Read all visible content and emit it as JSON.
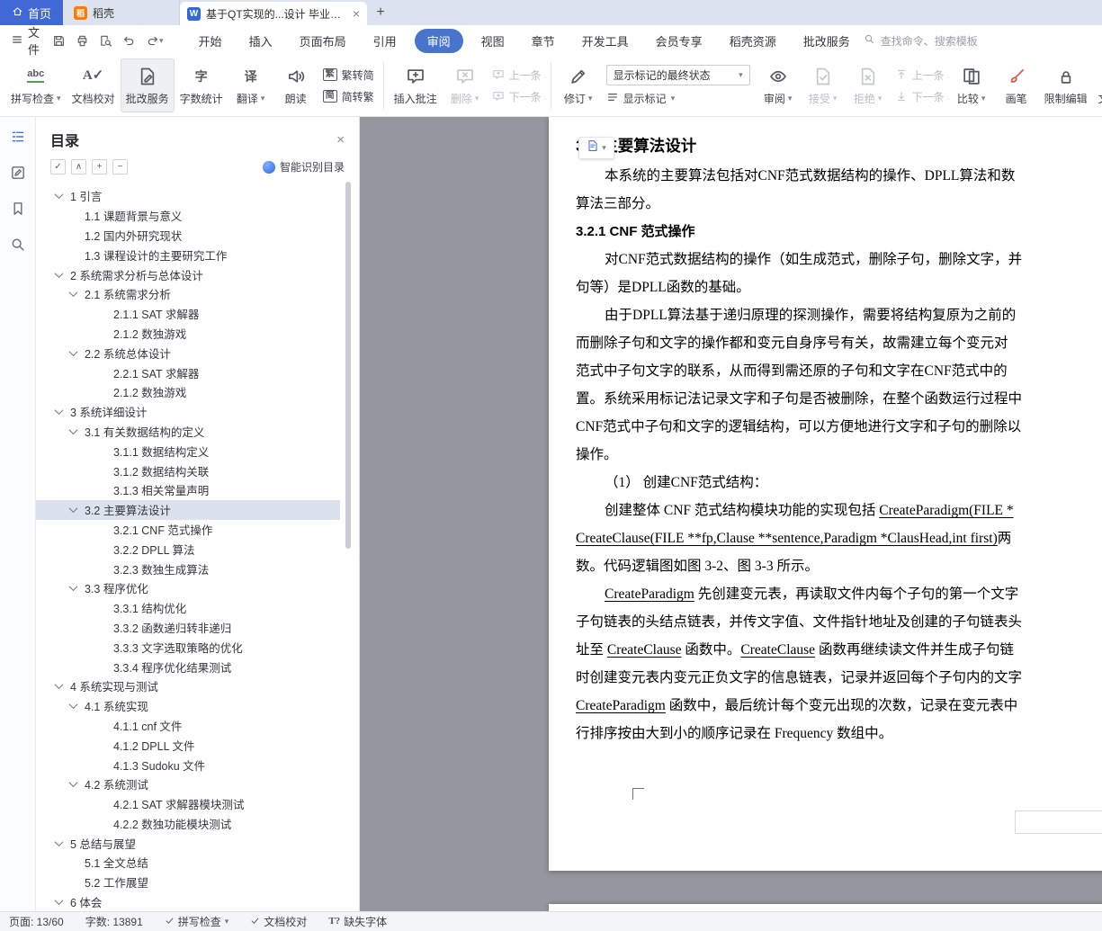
{
  "titlebar": {
    "home_tab": "首页",
    "docer_tab": "稻壳",
    "doc_tab": "基于QT实现的...设计 毕业论文",
    "close_glyph": "×",
    "new_tab_glyph": "+"
  },
  "menubar": {
    "file": "文件",
    "quick_access": [
      {
        "icon": "save-icon"
      },
      {
        "icon": "print-icon"
      },
      {
        "icon": "preview-icon"
      },
      {
        "icon": "undo-icon"
      },
      {
        "icon": "redo-icon",
        "dropdown": true
      }
    ],
    "items": [
      {
        "label": "开始"
      },
      {
        "label": "插入"
      },
      {
        "label": "页面布局"
      },
      {
        "label": "引用"
      },
      {
        "label": "审阅",
        "active": true
      },
      {
        "label": "视图"
      },
      {
        "label": "章节"
      },
      {
        "label": "开发工具"
      },
      {
        "label": "会员专享"
      },
      {
        "label": "稻壳资源"
      },
      {
        "label": "批改服务"
      }
    ],
    "search": "查找命令、搜索模板"
  },
  "ribbon": {
    "buttons": [
      {
        "type": "big",
        "label": "拼写检查",
        "icon": "spellcheck-icon",
        "dropdown": true
      },
      {
        "type": "big",
        "label": "文档校对",
        "icon": "proofread-icon"
      },
      {
        "type": "big",
        "label": "批改服务",
        "icon": "correction-icon",
        "active": true
      },
      {
        "type": "big",
        "label": "字数统计",
        "icon": "wordcount-icon"
      },
      {
        "type": "big",
        "label": "翻译",
        "icon": "translate-icon",
        "dropdown": true
      },
      {
        "type": "big",
        "label": "朗读",
        "icon": "read-aloud-icon"
      },
      {
        "type": "pair",
        "items": [
          {
            "label": "繁转简",
            "icon": "fan-to-jian-icon"
          },
          {
            "label": "简转繁",
            "icon": "jian-to-fan-icon"
          }
        ]
      },
      {
        "type": "sep"
      },
      {
        "type": "big",
        "label": "插入批注",
        "icon": "insert-comment-icon"
      },
      {
        "type": "big",
        "label": "删除",
        "icon": "delete-comment-icon",
        "dropdown": true,
        "disabled": true
      },
      {
        "type": "pair",
        "items": [
          {
            "label": "上一条",
            "icon": "prev-comment-icon",
            "disabled": true
          },
          {
            "label": "下一条",
            "icon": "next-comment-icon",
            "disabled": true
          }
        ]
      },
      {
        "type": "sep"
      },
      {
        "type": "big",
        "label": "修订",
        "icon": "track-changes-icon",
        "dropdown": true
      },
      {
        "type": "combo",
        "combo_value": "显示标记的最终状态",
        "show_marks_label": "显示标记",
        "show_marks_icon": "marks-list-icon"
      },
      {
        "type": "big",
        "label": "审阅",
        "icon": "review-icon",
        "dropdown": true
      },
      {
        "type": "big",
        "label": "接受",
        "icon": "accept-icon",
        "dropdown": true,
        "disabled": true
      },
      {
        "type": "big",
        "label": "拒绝",
        "icon": "reject-icon",
        "dropdown": true,
        "disabled": true
      },
      {
        "type": "pair",
        "items": [
          {
            "label": "上一条",
            "icon": "prev-change-icon",
            "disabled": true
          },
          {
            "label": "下一条",
            "icon": "next-change-icon",
            "disabled": true
          }
        ]
      },
      {
        "type": "big",
        "label": "比较",
        "icon": "compare-icon",
        "dropdown": true
      },
      {
        "type": "big",
        "label": "画笔",
        "icon": "brush-icon"
      },
      {
        "type": "big",
        "label": "限制编辑",
        "icon": "restrict-edit-icon"
      },
      {
        "type": "big",
        "label": "文档权限",
        "icon": "doc-permission-icon"
      }
    ]
  },
  "leftstrip": {
    "items": [
      {
        "icon": "outline-icon",
        "active": true
      },
      {
        "icon": "annotation-icon"
      },
      {
        "icon": "bookmark-icon"
      },
      {
        "icon": "search-icon"
      }
    ]
  },
  "toc": {
    "title": "目录",
    "close_glyph": "×",
    "tools": [
      {
        "glyph": "✓",
        "name": "toc-check-button"
      },
      {
        "glyph": "∧",
        "name": "toc-collapse-up-button"
      },
      {
        "glyph": "+",
        "name": "toc-expand-all-button"
      },
      {
        "glyph": "−",
        "name": "toc-collapse-all-button"
      }
    ],
    "smart_recognize": "智能识别目录",
    "items": [
      {
        "level": 1,
        "label": "1 引言",
        "chev": true
      },
      {
        "level": 2,
        "label": "1.1 课题背景与意义"
      },
      {
        "level": 2,
        "label": "1.2 国内外研究现状"
      },
      {
        "level": 2,
        "label": "1.3 课程设计的主要研究工作"
      },
      {
        "level": 1,
        "label": "2 系统需求分析与总体设计",
        "chev": true
      },
      {
        "level": 2,
        "label": "2.1 系统需求分析",
        "chev": true
      },
      {
        "level": 3,
        "label": "2.1.1 SAT 求解器"
      },
      {
        "level": 3,
        "label": "2.1.2 数独游戏"
      },
      {
        "level": 2,
        "label": "2.2 系统总体设计",
        "chev": true
      },
      {
        "level": 3,
        "label": "2.2.1 SAT 求解器"
      },
      {
        "level": 3,
        "label": "2.1.2 数独游戏"
      },
      {
        "level": 1,
        "label": "3 系统详细设计",
        "chev": true
      },
      {
        "level": 2,
        "label": "3.1 有关数据结构的定义",
        "chev": true
      },
      {
        "level": 3,
        "label": "3.1.1 数据结构定义"
      },
      {
        "level": 3,
        "label": "3.1.2 数据结构关联"
      },
      {
        "level": 3,
        "label": "3.1.3 相关常量声明"
      },
      {
        "level": 2,
        "label": "3.2 主要算法设计",
        "chev": true,
        "selected": true
      },
      {
        "level": 3,
        "label": "3.2.1 CNF 范式操作"
      },
      {
        "level": 3,
        "label": "3.2.2 DPLL 算法"
      },
      {
        "level": 3,
        "label": "3.2.3 数独生成算法"
      },
      {
        "level": 2,
        "label": "3.3 程序优化",
        "chev": true
      },
      {
        "level": 3,
        "label": "3.3.1 结构优化"
      },
      {
        "level": 3,
        "label": "3.3.2 函数递归转非递归"
      },
      {
        "level": 3,
        "label": "3.3.3 文字选取策略的优化"
      },
      {
        "level": 3,
        "label": "3.3.4 程序优化结果测试"
      },
      {
        "level": 1,
        "label": "4 系统实现与测试",
        "chev": true
      },
      {
        "level": 2,
        "label": "4.1 系统实现",
        "chev": true
      },
      {
        "level": 3,
        "label": "4.1.1 cnf 文件"
      },
      {
        "level": 3,
        "label": "4.1.2 DPLL 文件"
      },
      {
        "level": 3,
        "label": "4.1.3 Sudoku 文件"
      },
      {
        "level": 2,
        "label": "4.2 系统测试",
        "chev": true
      },
      {
        "level": 3,
        "label": "4.2.1 SAT 求解器模块测试"
      },
      {
        "level": 3,
        "label": "4.2.2 数独功能模块测试"
      },
      {
        "level": 1,
        "label": "5 总结与展望",
        "chev": true
      },
      {
        "level": 2,
        "label": "5.1 全文总结"
      },
      {
        "level": 2,
        "label": "5.2 工作展望"
      },
      {
        "level": 1,
        "label": "6 体会",
        "chev": true
      }
    ]
  },
  "document": {
    "comment_indicator_icon": "comment-page-icon",
    "lines": [
      {
        "style": "h1",
        "segs": [
          {
            "t": "3.2  主要算法设计"
          }
        ]
      },
      {
        "indent": true,
        "segs": [
          {
            "t": "本系统的主要算法包括对CNF范式数据结构的操作、DPLL算法和数"
          }
        ]
      },
      {
        "segs": [
          {
            "t": "算法三部分。"
          }
        ]
      },
      {
        "style": "h2",
        "segs": [
          {
            "t": "3.2.1 CNF 范式操作"
          }
        ]
      },
      {
        "indent": true,
        "segs": [
          {
            "t": "对CNF范式数据结构的操作（如生成范式，删除子句，删除文字，并"
          }
        ]
      },
      {
        "segs": [
          {
            "t": "句等）是DPLL函数的基础。"
          }
        ]
      },
      {
        "indent": true,
        "segs": [
          {
            "t": "由于DPLL算法基于递归原理的探测操作，需要将结构复原为之前的"
          }
        ]
      },
      {
        "segs": [
          {
            "t": "而删除子句和文字的操作都和变元自身序号有关，故需建立每个变元对"
          }
        ]
      },
      {
        "segs": [
          {
            "t": "范式中子句文字的联系，从而得到需还原的子句和文字在CNF范式中的"
          }
        ]
      },
      {
        "segs": [
          {
            "t": "置。系统采用标记法记录文字和子句是否被删除，在整个函数运行过程中"
          }
        ]
      },
      {
        "segs": [
          {
            "t": "CNF范式中子句和文字的逻辑结构，可以方便地进行文字和子句的删除以"
          }
        ]
      },
      {
        "segs": [
          {
            "t": "操作。"
          }
        ]
      },
      {
        "indent": true,
        "segs": [
          {
            "t": "（1） 创建CNF范式结构："
          }
        ]
      },
      {
        "indent": true,
        "segs": [
          {
            "t": "创建整体 CNF 范式结构模块功能的实现包括 "
          },
          {
            "t": "CreateParadigm(FILE *",
            "u": true
          }
        ]
      },
      {
        "segs": [
          {
            "t": "CreateClause(FILE **fp,Clause **sentence,Paradigm *ClausHead,int first)",
            "u": true
          },
          {
            "t": "两"
          }
        ]
      },
      {
        "segs": [
          {
            "t": "数。代码逻辑图如图 3-2、图 3-3 所示。"
          }
        ]
      },
      {
        "indent": true,
        "segs": [
          {
            "t": "CreateParadigm",
            "u": true
          },
          {
            "t": " 先创建变元表，再读取文件内每个子句的第一个文字"
          }
        ]
      },
      {
        "segs": [
          {
            "t": "子句链表的头结点链表，并传文字值、文件指针地址及创建的子句链表头"
          }
        ]
      },
      {
        "segs": [
          {
            "t": "址至 "
          },
          {
            "t": "CreateClause",
            "u": true
          },
          {
            "t": " 函数中。"
          },
          {
            "t": "CreateClause",
            "u": true
          },
          {
            "t": " 函数再继续读文件并生成子句链"
          }
        ]
      },
      {
        "segs": [
          {
            "t": "时创建变元表内变元正负文字的信息链表，记录并返回每个子句内的文字"
          }
        ]
      },
      {
        "segs": [
          {
            "t": "CreateParadigm",
            "u": true
          },
          {
            "t": " 函数中，最后统计每个变元出现的次数，记录在变元表中"
          }
        ]
      },
      {
        "segs": [
          {
            "t": "行排序按由大到小的顺序记录在 Frequency 数组中。"
          }
        ]
      }
    ]
  },
  "statusbar": {
    "page": "页面: 13/60",
    "wordcount": "字数: 13891",
    "spellcheck": "拼写检查",
    "proofread": "文档校对",
    "missing_font": "缺失字体",
    "missing_font_glyph": "T?"
  },
  "colors": {
    "accent_blue": "#4874cb",
    "home_blue": "#4169d6",
    "docer_orange": "#ff7a00",
    "canvas_gray": "#94989e",
    "toc_selected": "#dce2ed"
  }
}
